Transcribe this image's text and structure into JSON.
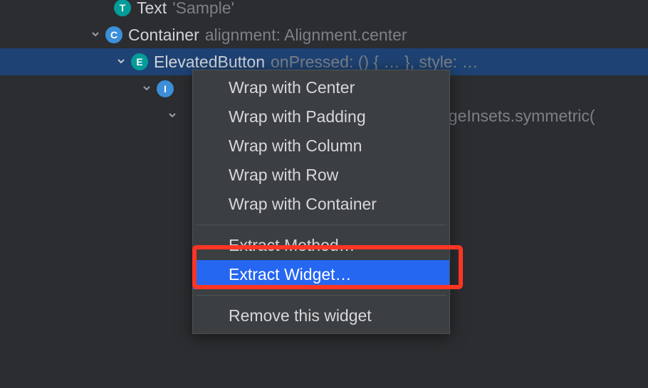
{
  "tree": {
    "row1": {
      "badge": "T",
      "name": "Text",
      "props": "'Sample'"
    },
    "row2": {
      "badge": "C",
      "name": "Container",
      "props": "alignment: Alignment.center"
    },
    "row3": {
      "badge": "E",
      "name": "ElevatedButton",
      "props": "onPressed: () { … }, style: …"
    },
    "row4": {
      "badge": "I"
    },
    "row5_props": "dgeInsets.symmetric("
  },
  "menu": {
    "group1": [
      "Wrap with Center",
      "Wrap with Padding",
      "Wrap with Column",
      "Wrap with Row",
      "Wrap with Container"
    ],
    "group2": [
      "Extract Method…",
      "Extract Widget…"
    ],
    "group3": [
      "Remove this widget"
    ],
    "selected": "Extract Widget…"
  }
}
